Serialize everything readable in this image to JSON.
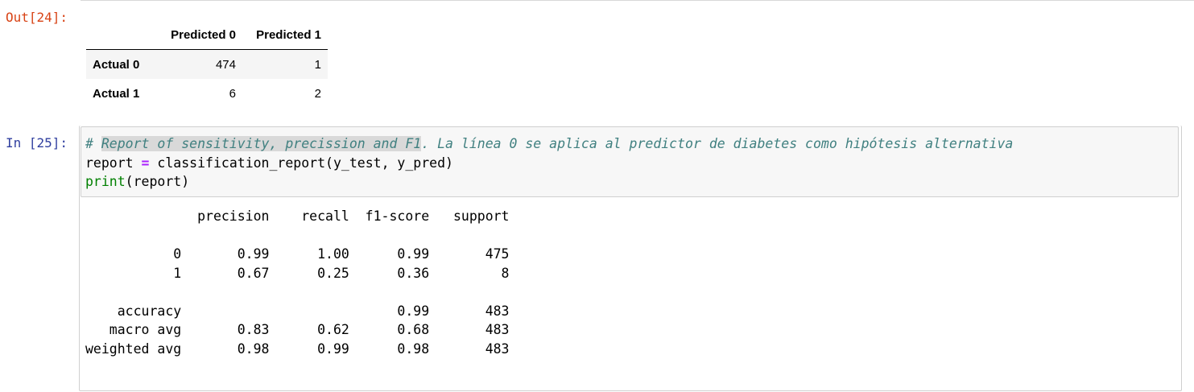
{
  "out_cell": {
    "prompt": "Out[24]:",
    "table": {
      "columns": [
        "Predicted 0",
        "Predicted 1"
      ],
      "rows": [
        {
          "label": "Actual 0",
          "values": [
            "474",
            "1"
          ]
        },
        {
          "label": "Actual 1",
          "values": [
            "6",
            "2"
          ]
        }
      ]
    }
  },
  "in_cell": {
    "prompt": "In [25]:",
    "code": {
      "comment_hash": "# ",
      "comment_highlight": "Report of sensitivity, precission and F1",
      "comment_rest": ". La línea 0 se aplica al predictor de diabetes como hipótesis alternativa",
      "line2_lhs": "report ",
      "line2_eq": "=",
      "line2_rhs": " classification_report(y_test, y_pred)",
      "line3_fn": "print",
      "line3_args": "(report)"
    },
    "output_lines": [
      "              precision    recall  f1-score   support",
      "",
      "           0       0.99      1.00      0.99       475",
      "           1       0.67      0.25      0.36         8",
      "",
      "    accuracy                           0.99       483",
      "   macro avg       0.83      0.62      0.68       483",
      "weighted avg       0.98      0.99      0.98       483"
    ]
  },
  "colors": {
    "out_prompt": "#d84315",
    "in_prompt": "#303f9f",
    "comment": "#408080",
    "builtin": "#008000",
    "operator": "#aa22ff"
  }
}
